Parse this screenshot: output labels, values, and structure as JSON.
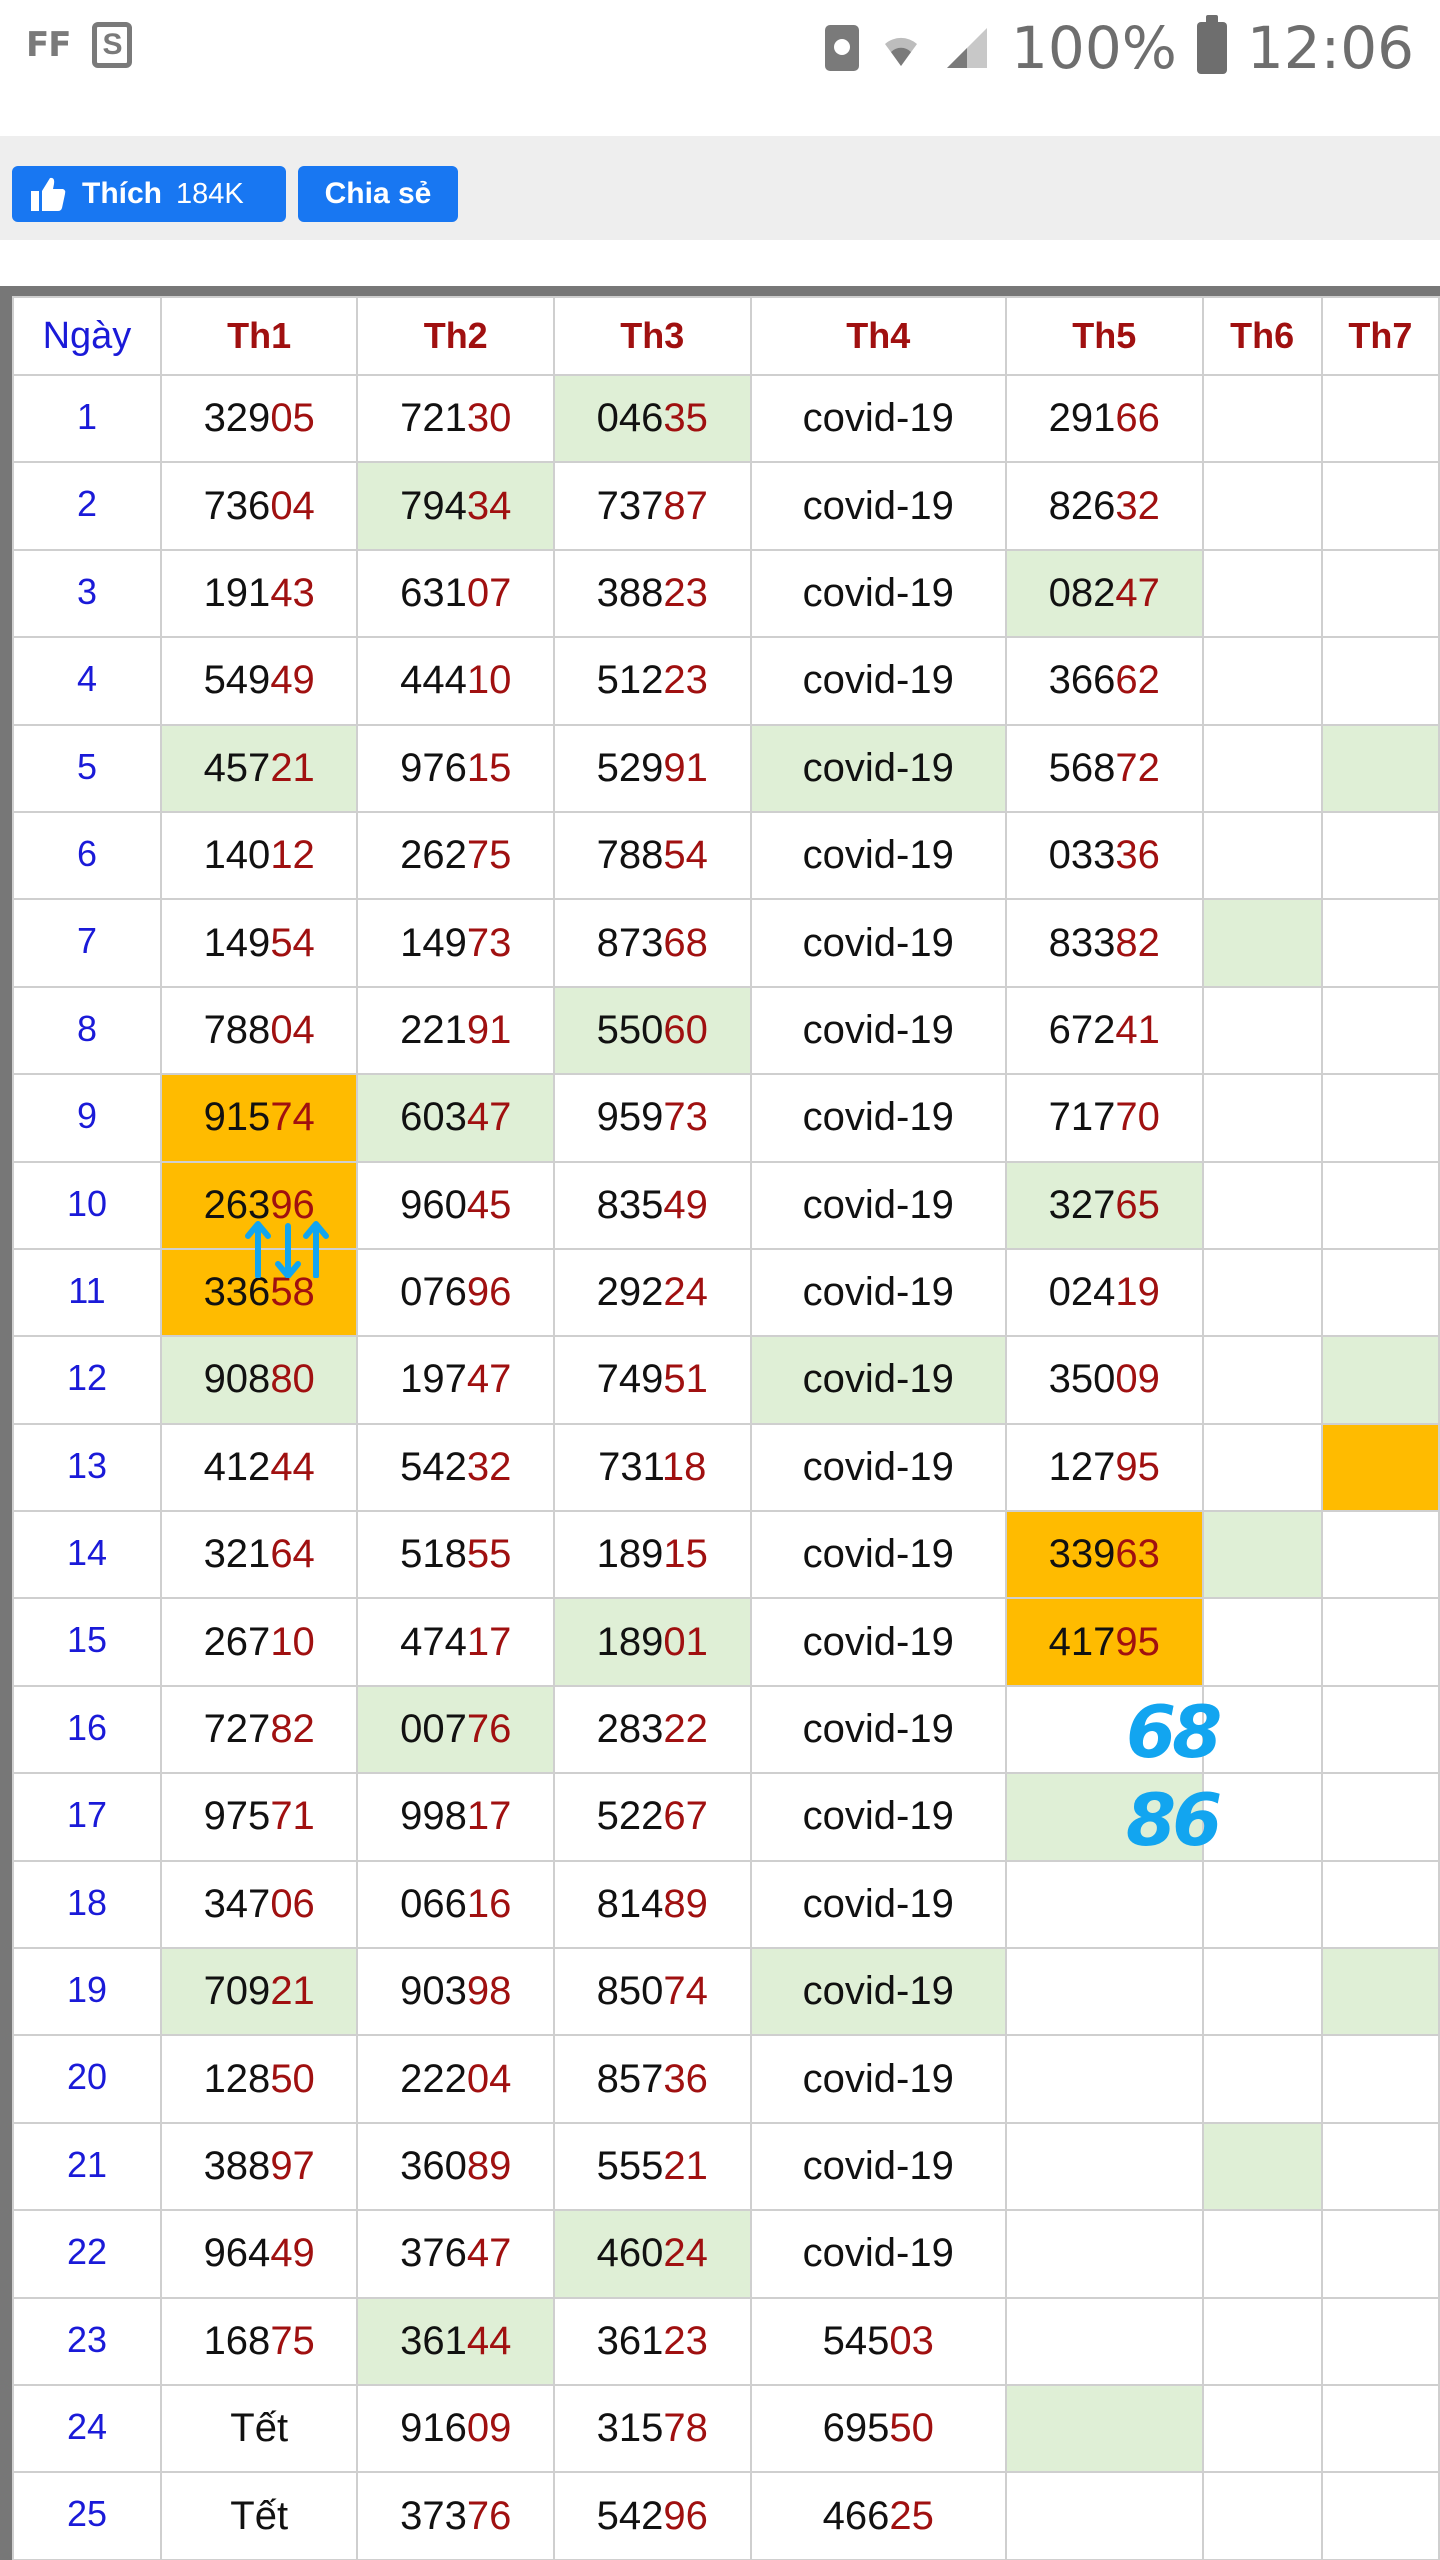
{
  "status_bar": {
    "left_label": "FF",
    "s_label": "S",
    "battery": "100%",
    "time": "12:06"
  },
  "share_bar": {
    "like_label": "Thích",
    "like_count": "184K",
    "share_label": "Chia sẻ"
  },
  "table": {
    "headers": [
      "Ngày",
      "Th1",
      "Th2",
      "Th3",
      "Th4",
      "Th5",
      "Th6",
      "Th7"
    ],
    "rows": [
      {
        "day": "1",
        "cells": [
          [
            "329",
            "05",
            ""
          ],
          [
            "721",
            "30",
            ""
          ],
          [
            "046",
            "35",
            "g"
          ],
          [
            "covid-19",
            "",
            ""
          ],
          [
            "291",
            "66",
            ""
          ],
          [
            "",
            "",
            ""
          ],
          [
            "",
            "",
            ""
          ]
        ]
      },
      {
        "day": "2",
        "cells": [
          [
            "736",
            "04",
            ""
          ],
          [
            "794",
            "34",
            "g"
          ],
          [
            "737",
            "87",
            ""
          ],
          [
            "covid-19",
            "",
            ""
          ],
          [
            "826",
            "32",
            ""
          ],
          [
            "",
            "",
            ""
          ],
          [
            "",
            "",
            ""
          ]
        ]
      },
      {
        "day": "3",
        "cells": [
          [
            "191",
            "43",
            ""
          ],
          [
            "631",
            "07",
            ""
          ],
          [
            "388",
            "23",
            ""
          ],
          [
            "covid-19",
            "",
            ""
          ],
          [
            "082",
            "47",
            "g"
          ],
          [
            "",
            "",
            ""
          ],
          [
            "",
            "",
            ""
          ]
        ]
      },
      {
        "day": "4",
        "cells": [
          [
            "549",
            "49",
            ""
          ],
          [
            "444",
            "10",
            ""
          ],
          [
            "512",
            "23",
            ""
          ],
          [
            "covid-19",
            "",
            ""
          ],
          [
            "366",
            "62",
            ""
          ],
          [
            "",
            "",
            ""
          ],
          [
            "",
            "",
            ""
          ]
        ]
      },
      {
        "day": "5",
        "cells": [
          [
            "457",
            "21",
            "g"
          ],
          [
            "976",
            "15",
            ""
          ],
          [
            "529",
            "91",
            ""
          ],
          [
            "covid-19",
            "",
            "g"
          ],
          [
            "568",
            "72",
            ""
          ],
          [
            "",
            "",
            ""
          ],
          [
            "",
            "",
            "g"
          ]
        ]
      },
      {
        "day": "6",
        "cells": [
          [
            "140",
            "12",
            ""
          ],
          [
            "262",
            "75",
            ""
          ],
          [
            "788",
            "54",
            ""
          ],
          [
            "covid-19",
            "",
            ""
          ],
          [
            "033",
            "36",
            ""
          ],
          [
            "",
            "",
            ""
          ],
          [
            "",
            "",
            ""
          ]
        ]
      },
      {
        "day": "7",
        "cells": [
          [
            "149",
            "54",
            ""
          ],
          [
            "149",
            "73",
            ""
          ],
          [
            "873",
            "68",
            ""
          ],
          [
            "covid-19",
            "",
            ""
          ],
          [
            "833",
            "82",
            ""
          ],
          [
            "",
            "",
            "g"
          ],
          [
            "",
            "",
            ""
          ]
        ]
      },
      {
        "day": "8",
        "cells": [
          [
            "788",
            "04",
            ""
          ],
          [
            "221",
            "91",
            ""
          ],
          [
            "550",
            "60",
            "g"
          ],
          [
            "covid-19",
            "",
            ""
          ],
          [
            "672",
            "41",
            ""
          ],
          [
            "",
            "",
            ""
          ],
          [
            "",
            "",
            ""
          ]
        ]
      },
      {
        "day": "9",
        "cells": [
          [
            "915",
            "74",
            "o"
          ],
          [
            "603",
            "47",
            "g"
          ],
          [
            "959",
            "73",
            ""
          ],
          [
            "covid-19",
            "",
            ""
          ],
          [
            "717",
            "70",
            ""
          ],
          [
            "",
            "",
            ""
          ],
          [
            "",
            "",
            ""
          ]
        ]
      },
      {
        "day": "10",
        "cells": [
          [
            "263",
            "96",
            "o"
          ],
          [
            "960",
            "45",
            ""
          ],
          [
            "835",
            "49",
            ""
          ],
          [
            "covid-19",
            "",
            ""
          ],
          [
            "327",
            "65",
            "g"
          ],
          [
            "",
            "",
            ""
          ],
          [
            "",
            "",
            ""
          ]
        ]
      },
      {
        "day": "11",
        "cells": [
          [
            "336",
            "58",
            "o"
          ],
          [
            "076",
            "96",
            ""
          ],
          [
            "292",
            "24",
            ""
          ],
          [
            "covid-19",
            "",
            ""
          ],
          [
            "024",
            "19",
            ""
          ],
          [
            "",
            "",
            ""
          ],
          [
            "",
            "",
            ""
          ]
        ]
      },
      {
        "day": "12",
        "cells": [
          [
            "908",
            "80",
            "g"
          ],
          [
            "197",
            "47",
            ""
          ],
          [
            "749",
            "51",
            ""
          ],
          [
            "covid-19",
            "",
            "g"
          ],
          [
            "350",
            "09",
            ""
          ],
          [
            "",
            "",
            ""
          ],
          [
            "",
            "",
            "g"
          ]
        ]
      },
      {
        "day": "13",
        "cells": [
          [
            "412",
            "44",
            ""
          ],
          [
            "542",
            "32",
            ""
          ],
          [
            "731",
            "18",
            ""
          ],
          [
            "covid-19",
            "",
            ""
          ],
          [
            "127",
            "95",
            ""
          ],
          [
            "",
            "",
            ""
          ],
          [
            "",
            "",
            "o"
          ]
        ]
      },
      {
        "day": "14",
        "cells": [
          [
            "321",
            "64",
            ""
          ],
          [
            "518",
            "55",
            ""
          ],
          [
            "189",
            "15",
            ""
          ],
          [
            "covid-19",
            "",
            ""
          ],
          [
            "339",
            "63",
            "o"
          ],
          [
            "",
            "",
            "g"
          ],
          [
            "",
            "",
            ""
          ]
        ]
      },
      {
        "day": "15",
        "cells": [
          [
            "267",
            "10",
            ""
          ],
          [
            "474",
            "17",
            ""
          ],
          [
            "189",
            "01",
            "g"
          ],
          [
            "covid-19",
            "",
            ""
          ],
          [
            "417",
            "95",
            "o"
          ],
          [
            "",
            "",
            ""
          ],
          [
            "",
            "",
            ""
          ]
        ]
      },
      {
        "day": "16",
        "cells": [
          [
            "727",
            "82",
            ""
          ],
          [
            "007",
            "76",
            "g"
          ],
          [
            "283",
            "22",
            ""
          ],
          [
            "covid-19",
            "",
            ""
          ],
          [
            "",
            "",
            ""
          ],
          [
            "",
            "",
            ""
          ],
          [
            "",
            "",
            ""
          ]
        ]
      },
      {
        "day": "17",
        "cells": [
          [
            "975",
            "71",
            ""
          ],
          [
            "998",
            "17",
            ""
          ],
          [
            "522",
            "67",
            ""
          ],
          [
            "covid-19",
            "",
            ""
          ],
          [
            "",
            "",
            "g"
          ],
          [
            "",
            "",
            ""
          ],
          [
            "",
            "",
            ""
          ]
        ]
      },
      {
        "day": "18",
        "cells": [
          [
            "347",
            "06",
            ""
          ],
          [
            "066",
            "16",
            ""
          ],
          [
            "814",
            "89",
            ""
          ],
          [
            "covid-19",
            "",
            ""
          ],
          [
            "",
            "",
            ""
          ],
          [
            "",
            "",
            ""
          ],
          [
            "",
            "",
            ""
          ]
        ]
      },
      {
        "day": "19",
        "cells": [
          [
            "709",
            "21",
            "g"
          ],
          [
            "903",
            "98",
            ""
          ],
          [
            "850",
            "74",
            ""
          ],
          [
            "covid-19",
            "",
            "g"
          ],
          [
            "",
            "",
            ""
          ],
          [
            "",
            "",
            ""
          ],
          [
            "",
            "",
            "g"
          ]
        ]
      },
      {
        "day": "20",
        "cells": [
          [
            "128",
            "50",
            ""
          ],
          [
            "222",
            "04",
            ""
          ],
          [
            "857",
            "36",
            ""
          ],
          [
            "covid-19",
            "",
            ""
          ],
          [
            "",
            "",
            ""
          ],
          [
            "",
            "",
            ""
          ],
          [
            "",
            "",
            ""
          ]
        ]
      },
      {
        "day": "21",
        "cells": [
          [
            "388",
            "97",
            ""
          ],
          [
            "360",
            "89",
            ""
          ],
          [
            "555",
            "21",
            ""
          ],
          [
            "covid-19",
            "",
            ""
          ],
          [
            "",
            "",
            ""
          ],
          [
            "",
            "",
            "g"
          ],
          [
            "",
            "",
            ""
          ]
        ]
      },
      {
        "day": "22",
        "cells": [
          [
            "964",
            "49",
            ""
          ],
          [
            "376",
            "47",
            ""
          ],
          [
            "460",
            "24",
            "g"
          ],
          [
            "covid-19",
            "",
            ""
          ],
          [
            "",
            "",
            ""
          ],
          [
            "",
            "",
            ""
          ],
          [
            "",
            "",
            ""
          ]
        ]
      },
      {
        "day": "23",
        "cells": [
          [
            "168",
            "75",
            ""
          ],
          [
            "361",
            "44",
            "g"
          ],
          [
            "361",
            "23",
            ""
          ],
          [
            "545",
            "03",
            ""
          ],
          [
            "",
            "",
            ""
          ],
          [
            "",
            "",
            ""
          ],
          [
            "",
            "",
            ""
          ]
        ]
      },
      {
        "day": "24",
        "cells": [
          [
            "Tết",
            "",
            ""
          ],
          [
            "916",
            "09",
            ""
          ],
          [
            "315",
            "78",
            ""
          ],
          [
            "695",
            "50",
            ""
          ],
          [
            "",
            "",
            "g"
          ],
          [
            "",
            "",
            ""
          ],
          [
            "",
            "",
            ""
          ]
        ]
      },
      {
        "day": "25",
        "cells": [
          [
            "Tết",
            "",
            ""
          ],
          [
            "373",
            "76",
            ""
          ],
          [
            "542",
            "96",
            ""
          ],
          [
            "466",
            "25",
            ""
          ],
          [
            "",
            "",
            ""
          ],
          [
            "",
            "",
            ""
          ],
          [
            "",
            "",
            ""
          ]
        ]
      }
    ]
  },
  "annotations": {
    "handwritten_1": "68",
    "handwritten_2": "86",
    "arrow_color": "#12a5f0"
  },
  "colors": {
    "green_highlight": "#dfefd6",
    "orange_highlight": "#ffbb00",
    "header_red": "#a01010",
    "day_blue": "#1a1ad8",
    "fb_blue": "#1877f2"
  }
}
